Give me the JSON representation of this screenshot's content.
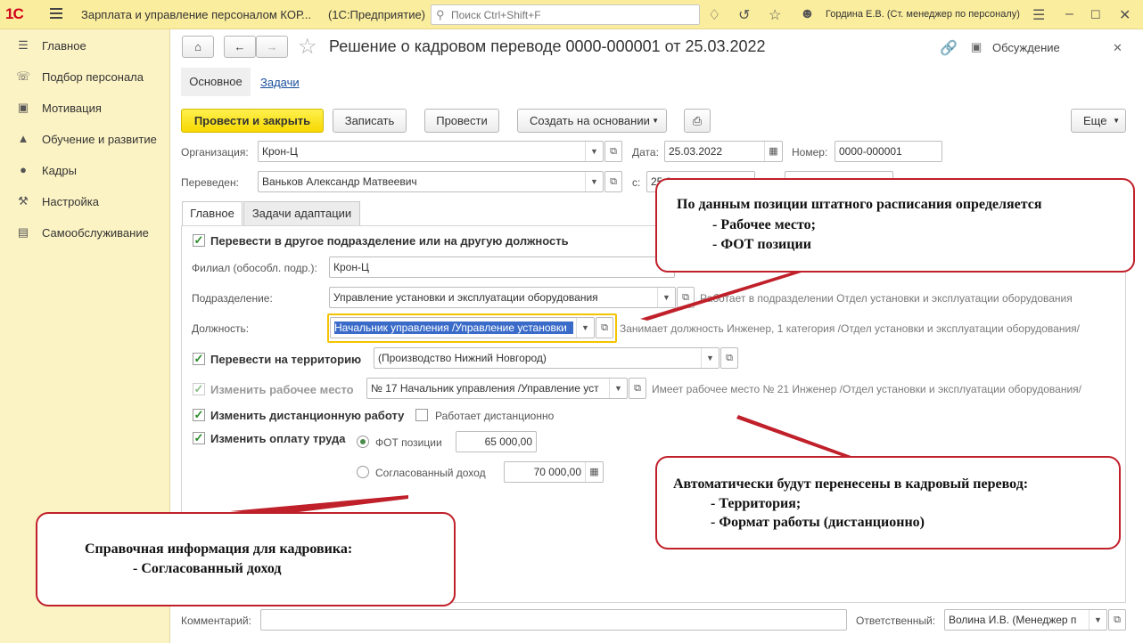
{
  "titlebar": {
    "logo": "1С",
    "app_title": "Зарплата и управление персоналом КОР...",
    "app_sub": "(1С:Предприятие)",
    "search_placeholder": "Поиск Ctrl+Shift+F",
    "user": "Гордина Е.В. (Ст. менеджер по персоналу)"
  },
  "sidebar": {
    "items": [
      {
        "label": "Главное",
        "icon": "list-icon"
      },
      {
        "label": "Подбор персонала",
        "icon": "phone-icon"
      },
      {
        "label": "Мотивация",
        "icon": "gift-icon"
      },
      {
        "label": "Обучение и развитие",
        "icon": "graduation-cap-icon"
      },
      {
        "label": "Кадры",
        "icon": "people-icon"
      },
      {
        "label": "Настройка",
        "icon": "wrench-icon"
      },
      {
        "label": "Самообслуживание",
        "icon": "card-icon"
      }
    ]
  },
  "doc": {
    "title": "Решение о кадровом переводе 0000-000001 от 25.03.2022",
    "discussion": "Обсуждение",
    "nav_main": "Основное",
    "nav_tasks": "Задачи"
  },
  "toolbar": {
    "post_close": "Провести и закрыть",
    "write": "Записать",
    "post": "Провести",
    "create_based": "Создать на основании",
    "more": "Еще"
  },
  "form": {
    "org_label": "Организация:",
    "org_value": "Крон-Ц",
    "date_label": "Дата:",
    "date_value": "25.03.2022",
    "number_label": "Номер:",
    "number_value": "0000-000001",
    "transferred_label": "Переведен:",
    "transferred_value": "Ваньков Александр Матвеевич",
    "from_label": "с:",
    "from_value": "25.0",
    "tabs": [
      "Главное",
      "Задачи адаптации"
    ],
    "cb_transfer": "Перевести в другое подразделение или на другую должность",
    "branch_label": "Филиал (обособл. подр.):",
    "branch_value": "Крон-Ц",
    "division_label": "Подразделение:",
    "division_value": "Управление установки и эксплуатации оборудования",
    "division_info": "Работает в подразделении Отдел установки и эксплуатации оборудования",
    "position_label": "Должность:",
    "position_value": "Начальник управления /Управление установки",
    "position_info": "Занимает должность Инженер, 1 категория /Отдел установки и эксплуатации оборудования/",
    "cb_territory": "Перевести на территорию",
    "territory_value": "(Производство Нижний Новгород)",
    "cb_workplace": "Изменить рабочее место",
    "workplace_value": "№ 17 Начальник управления /Управление уст",
    "workplace_info": "Имеет рабочее место № 21 Инженер /Отдел установки и эксплуатации оборудования/",
    "cb_remote": "Изменить дистанционную работу",
    "remote_label": "Работает дистанционно",
    "cb_pay": "Изменить оплату труда",
    "fot_label": "ФОТ позиции",
    "fot_value": "65 000,00",
    "agreed_label": "Согласованный доход",
    "agreed_value": "70 000,00",
    "comment_label": "Комментарий:",
    "responsible_label": "Ответственный:",
    "responsible_value": "Волина И.В. (Менеджер п"
  },
  "callouts": {
    "top": [
      "По данным позиции штатного расписания определяется",
      "- Рабочее место;",
      "- ФОТ позиции"
    ],
    "right": [
      "Автоматически будут перенесены в кадровый перевод:",
      "- Территория;",
      "- Формат работы (дистанционно)"
    ],
    "left": [
      "Справочная информация для кадровика:",
      "- Согласованный доход"
    ]
  },
  "colors": {
    "titlebar": "#fbed9e",
    "sidebar": "#fcf3c4",
    "primary_button": "#f6d800",
    "callout_border": "#c0202a",
    "focus_border": "#f5c400"
  }
}
